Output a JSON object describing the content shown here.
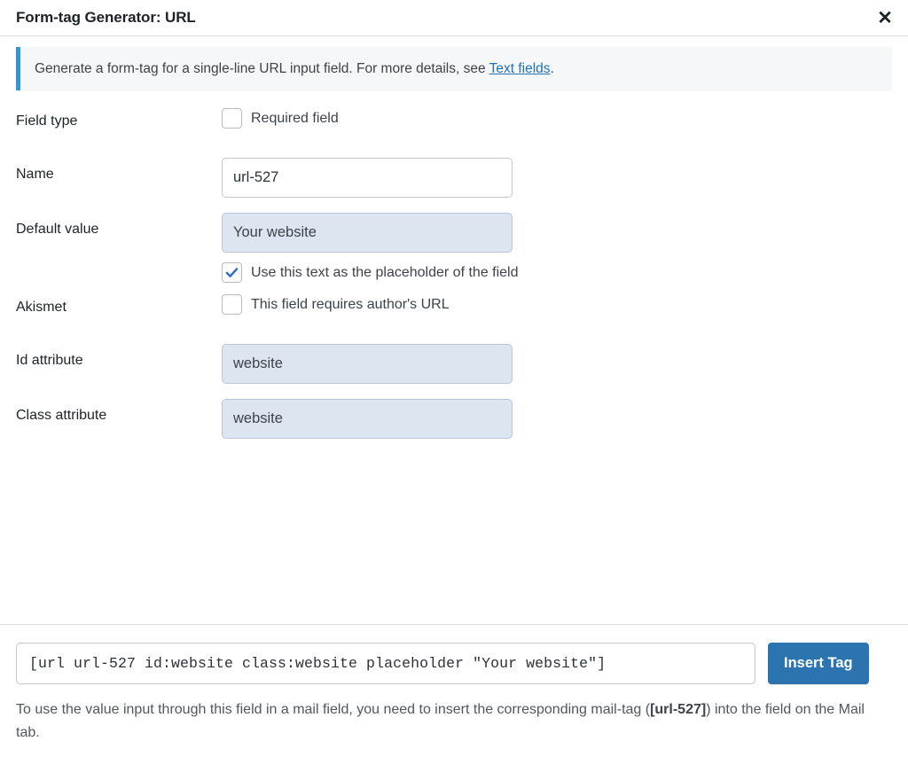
{
  "header": {
    "title": "Form-tag Generator: URL",
    "close_icon": "close-icon",
    "close_glyph": "✕"
  },
  "notice": {
    "text_before": "Generate a form-tag for a single-line URL input field. For more details, see ",
    "link_text": "Text fields",
    "text_after": ".",
    "accent_color": "#3397d4",
    "background": "#f6f7f8"
  },
  "form": {
    "rows": [
      {
        "label": "Field type",
        "control": "checkbox",
        "checkbox_label": "Required field",
        "checked": false
      },
      {
        "label": "Name",
        "control": "text",
        "value": "url-527",
        "autofilled": false
      },
      {
        "label": "Default value",
        "control": "text",
        "value": "Your website",
        "autofilled": true,
        "sub_checkbox_label": "Use this text as the placeholder of the field",
        "sub_checked": true
      },
      {
        "label": "Akismet",
        "control": "checkbox",
        "checkbox_label": "This field requires author's URL",
        "checked": false
      },
      {
        "label": "Id attribute",
        "control": "text",
        "value": "website",
        "autofilled": true
      },
      {
        "label": "Class attribute",
        "control": "text",
        "value": "website",
        "autofilled": true
      }
    ]
  },
  "footer": {
    "tag_value": "[url url-527 id:website class:website placeholder \"Your website\"]",
    "insert_button_label": "Insert Tag",
    "insert_button_color": "#2b74b0",
    "help_part1": "To use the value input through this field in a mail field, you need to insert the corresponding mail-tag (",
    "help_tag": "[url-527]",
    "help_part2": ") into the field on the Mail tab."
  }
}
